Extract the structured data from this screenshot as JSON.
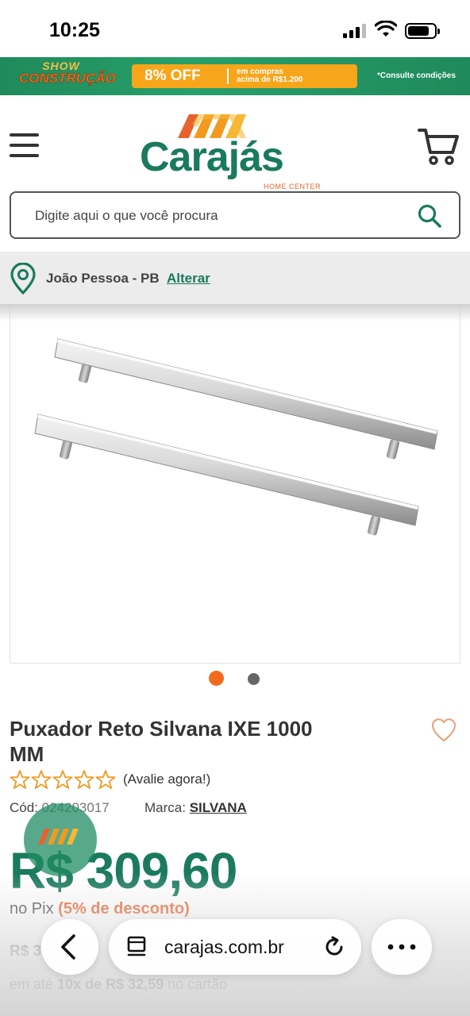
{
  "status_bar": {
    "time": "10:25"
  },
  "promo_banner": {
    "show_line1": "SHOW",
    "show_line2": "CONSTRUÇÃO",
    "discount": "8% OFF",
    "condition_line1": "em compras",
    "condition_line2": "acima de R$1.200",
    "note": "*Consulte condições"
  },
  "header": {
    "logo_text": "Carajás",
    "logo_subtitle": "HOME CENTER"
  },
  "search": {
    "placeholder": "Digite aqui o que você procura",
    "value": ""
  },
  "location": {
    "city": "João Pessoa - PB",
    "change_link": "Alterar"
  },
  "gallery": {
    "active_index": 0,
    "total": 2
  },
  "product": {
    "title": "Puxador Reto Silvana IXE 1000 MM",
    "rating_stars": 5,
    "rating_value": 0,
    "rate_prompt": "(Avalie agora!)",
    "code_label": "Cód:",
    "code": "024203017",
    "brand_label": "Marca:",
    "brand": "SILVANA",
    "price": "R$ 309,60",
    "pix_prefix": "no Pix",
    "pix_discount": "(5% de desconto)",
    "old_price_visible": "R$ 3",
    "installments_prefix": "em até",
    "installments_value": "10x de R$ 32,59",
    "installments_suffix": "no cartão"
  },
  "browser": {
    "url": "carajas.com.br"
  },
  "colors": {
    "brand_green": "#1a7a5e",
    "accent_orange": "#e8622c",
    "star_orange": "#f29a1f"
  },
  "icons": [
    "menu-icon",
    "cart-icon",
    "search-icon",
    "location-pin-icon",
    "heart-icon",
    "star-icon",
    "back-arrow-icon",
    "tab-icon",
    "reload-icon",
    "more-icon"
  ]
}
